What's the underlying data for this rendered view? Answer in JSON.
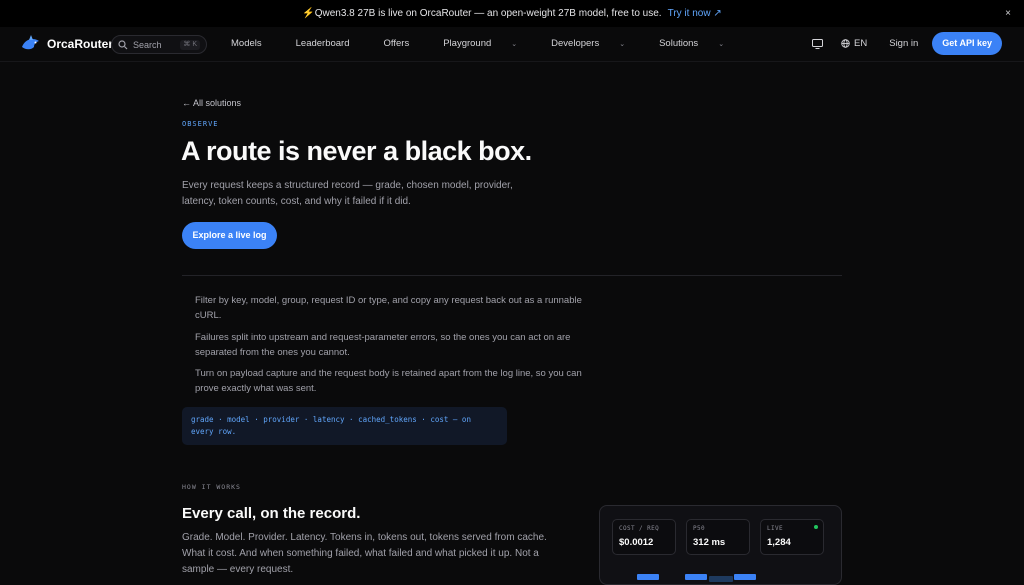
{
  "banner": {
    "text": "⚡Qwen3.8 27B is live on OrcaRouter — an open-weight 27B model, free to use.",
    "link": "Try it now ↗",
    "close": "×"
  },
  "nav": {
    "logo": "OrcaRouter",
    "search_placeholder": "Search",
    "search_shortcut": "⌘ K",
    "items": [
      {
        "label": "Models",
        "chevron": ""
      },
      {
        "label": "Leaderboard",
        "chevron": ""
      },
      {
        "label": "Offers",
        "chevron": ""
      },
      {
        "label": "Playground",
        "chevron": "⌄"
      },
      {
        "label": "Developers",
        "chevron": "⌄"
      },
      {
        "label": "Solutions",
        "chevron": "⌄"
      }
    ],
    "lang": "EN",
    "signin": "Sign in",
    "cta": "Get API key"
  },
  "hero": {
    "back": "← All solutions",
    "eyebrow": "OBSERVE",
    "title": "A route is never a black box.",
    "lede": "Every request keeps a structured record — grade, chosen model, provider, latency, token counts, cost, and why it failed if it did.",
    "cta": "Explore a live log"
  },
  "features": [
    "Filter by key, model, group, request ID or type, and copy any request back out as a runnable cURL.",
    "Failures split into upstream and request-parameter errors, so the ones you can act on are separated from the ones you cannot.",
    "Turn on payload capture and the request body is retained apart from the log line, so you can prove exactly what was sent."
  ],
  "code": "grade · model · provider · latency · cached_tokens · cost — on every row.",
  "how": {
    "eyebrow": "HOW IT WORKS",
    "title": "Every call, on the record.",
    "body": "Grade. Model. Provider. Latency. Tokens in, tokens out, tokens served from cache. What it cost. And when something failed, what failed and what picked it up. Not a sample — every request."
  },
  "stats": [
    {
      "label": "COST / REQ",
      "value": "$0.0012"
    },
    {
      "label": "P50",
      "value": "312 ms"
    },
    {
      "label": "LIVE",
      "value": "1,284"
    }
  ],
  "colors": {
    "accent": "#3b82f6",
    "live": "#22c55e"
  }
}
